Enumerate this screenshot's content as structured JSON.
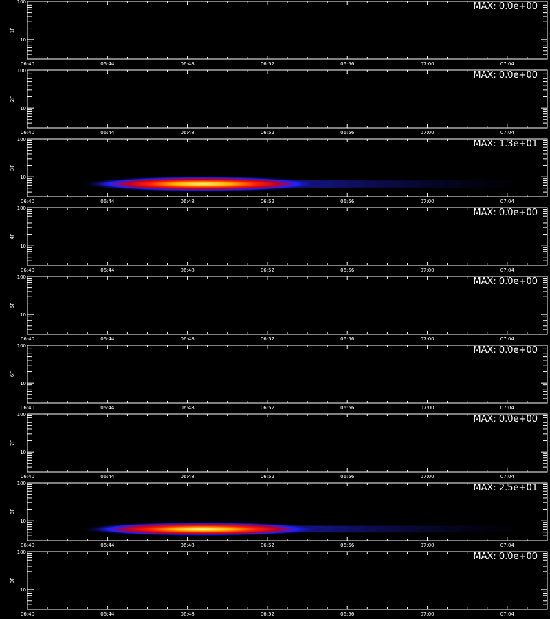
{
  "chart_data": [
    {
      "type": "heatmap",
      "ylabel": "1F",
      "max_label": "MAX: 0.0e+00",
      "max_value": 0.0,
      "features": []
    },
    {
      "type": "heatmap",
      "ylabel": "2F",
      "max_label": "MAX: 0.0e+00",
      "max_value": 0.0,
      "features": []
    },
    {
      "type": "heatmap",
      "ylabel": "3F",
      "max_label": "MAX: 1.3e+01",
      "max_value": 13.0,
      "features": [
        {
          "t_start": "06:46:30",
          "t_peak": "06:50:00",
          "t_end": "07:05:00",
          "y_center": 6.5,
          "y_low": 4.5,
          "y_high": 8.5
        }
      ]
    },
    {
      "type": "heatmap",
      "ylabel": "4F",
      "max_label": "MAX: 0.0e+00",
      "max_value": 0.0,
      "features": []
    },
    {
      "type": "heatmap",
      "ylabel": "5F",
      "max_label": "MAX: 0.0e+00",
      "max_value": 0.0,
      "features": []
    },
    {
      "type": "heatmap",
      "ylabel": "6F",
      "max_label": "MAX: 0.0e+00",
      "max_value": 0.0,
      "features": []
    },
    {
      "type": "heatmap",
      "ylabel": "7F",
      "max_label": "MAX: 0.0e+00",
      "max_value": 0.0,
      "features": []
    },
    {
      "type": "heatmap",
      "ylabel": "8F",
      "max_label": "MAX: 2.5e+01",
      "max_value": 25.0,
      "features": [
        {
          "t_start": "06:46:30",
          "t_peak": "06:50:00",
          "t_end": "07:05:00",
          "y_center": 6.0,
          "y_low": 4.5,
          "y_high": 8.0
        }
      ]
    },
    {
      "type": "heatmap",
      "ylabel": "9F",
      "max_label": "MAX: 0.0e+00",
      "max_value": 0.0,
      "features": []
    }
  ],
  "axes": {
    "x_ticks": [
      "06:40",
      "06:44",
      "06:48",
      "06:52",
      "06:56",
      "07:00",
      "07:04"
    ],
    "x_range": [
      "06:40",
      "07:06"
    ],
    "y_ticks": [
      "10",
      "100"
    ],
    "y_scale": "log",
    "y_range": [
      3,
      100
    ]
  },
  "colors": {
    "background": "#000000",
    "axis": "#ffffff",
    "colormap": [
      "#000000",
      "#1010c0",
      "#3030ff",
      "#c00000",
      "#ff3000",
      "#ffa000",
      "#ffff80"
    ]
  }
}
